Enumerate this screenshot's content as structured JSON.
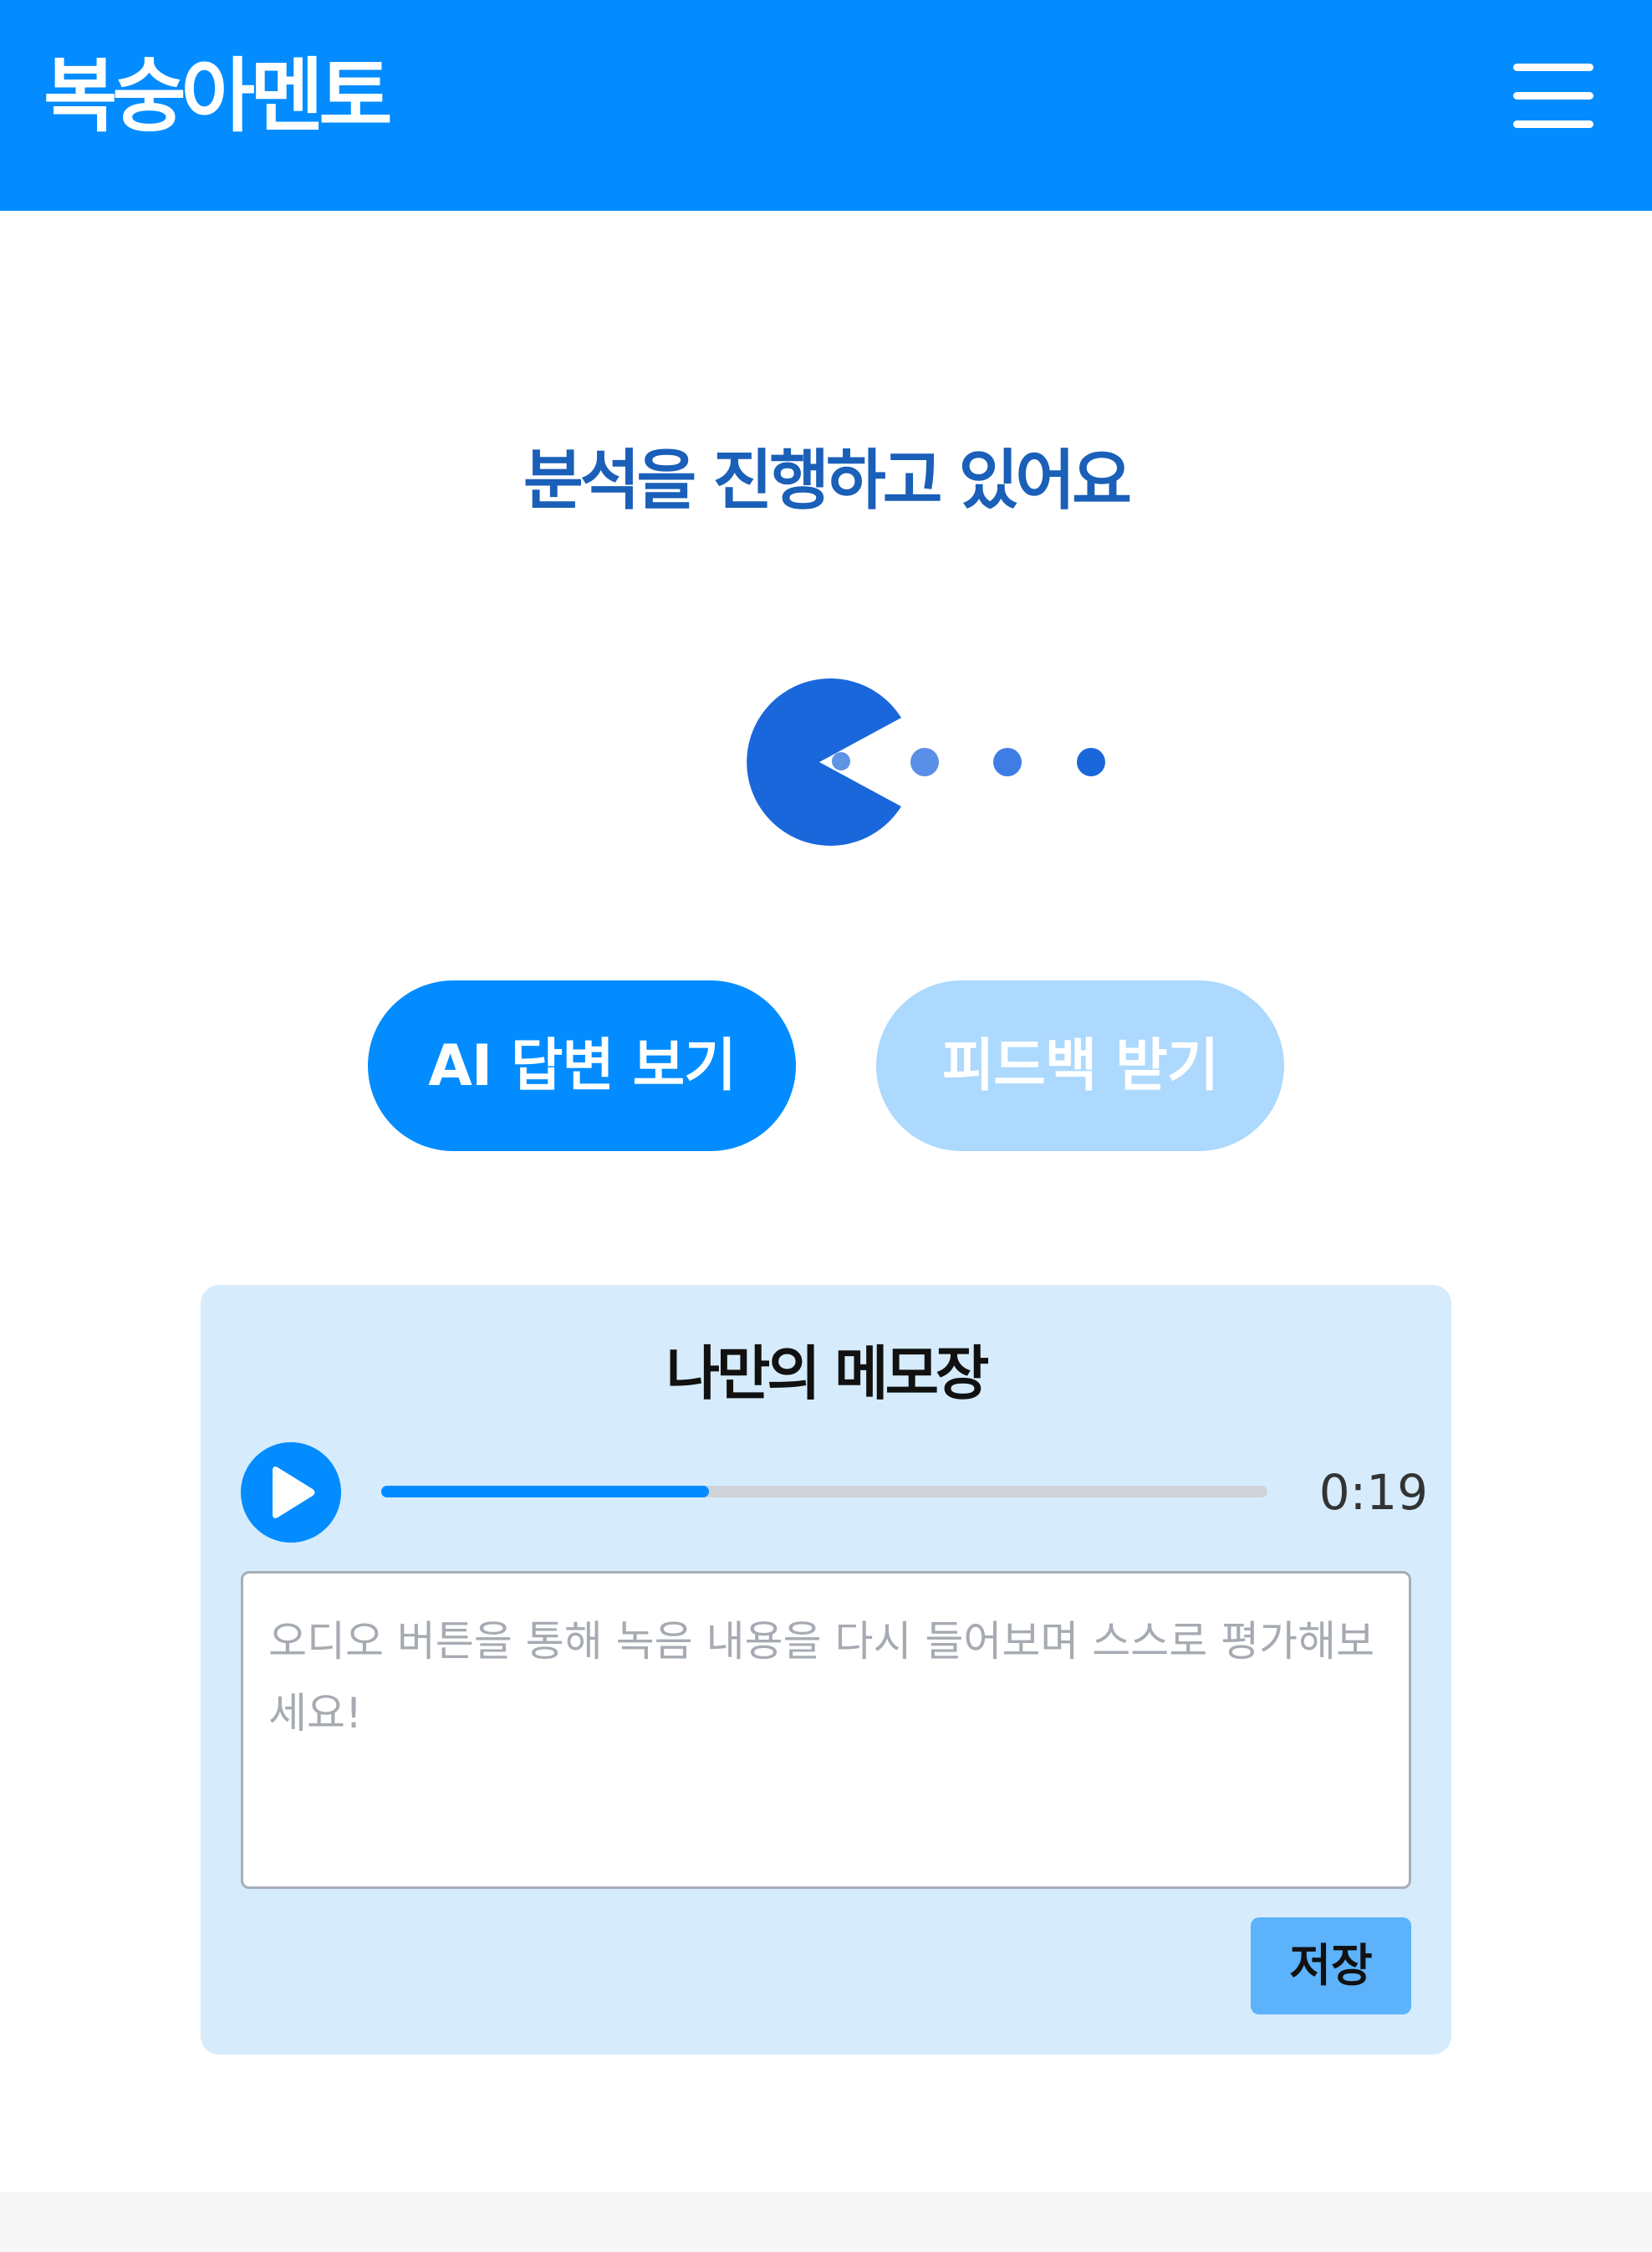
{
  "header": {
    "app_title": "복숭아멘토",
    "menu_icon": "hamburger-menu-icon",
    "background_color": "#028cff"
  },
  "status": {
    "title": "분석을 진행하고 있어요",
    "title_color": "#1a5fb8",
    "loader_icon": "pacman-loading-icon"
  },
  "actions": {
    "ai_answer_label": "AI 답변 보기",
    "feedback_label": "피드백 받기"
  },
  "memo": {
    "title": "나만의 메모장",
    "player": {
      "play_icon": "play-icon",
      "progress": 0.37,
      "time": "0:19"
    },
    "textarea": {
      "value": "",
      "placeholder": "오디오 버튼을 통해 녹음 내용을 다시 들어보며 스스로 평가해보세요!"
    },
    "save_label": "저장"
  }
}
